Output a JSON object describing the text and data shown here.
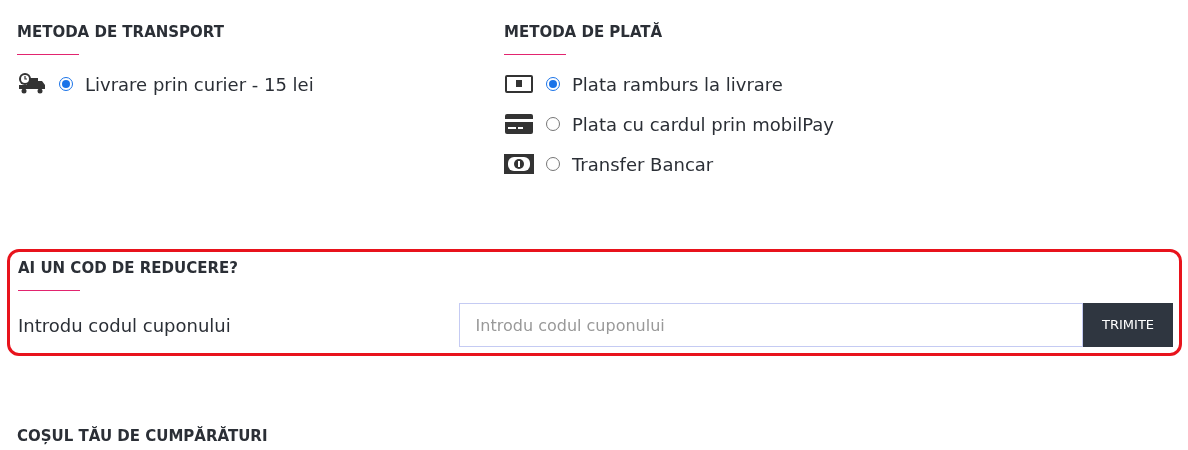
{
  "transport": {
    "title": "METODA DE TRANSPORT",
    "options": [
      {
        "kind": "truck",
        "label": "Livrare prin curier - 15 lei",
        "selected": true
      }
    ]
  },
  "payment": {
    "title": "METODA DE PLATĂ",
    "options": [
      {
        "kind": "cash",
        "label": "Plata ramburs la livrare",
        "selected": true
      },
      {
        "kind": "card",
        "label": "Plata cu cardul prin mobilPay",
        "selected": false
      },
      {
        "kind": "bill",
        "label": "Transfer Bancar",
        "selected": false
      }
    ]
  },
  "coupon": {
    "title": "AI UN COD DE REDUCERE?",
    "label": "Introdu codul cuponului",
    "placeholder": "Introdu codul cuponului",
    "button": "TRIMITE"
  },
  "cart": {
    "title": "COȘUL TĂU DE CUMPĂRĂTURI"
  }
}
